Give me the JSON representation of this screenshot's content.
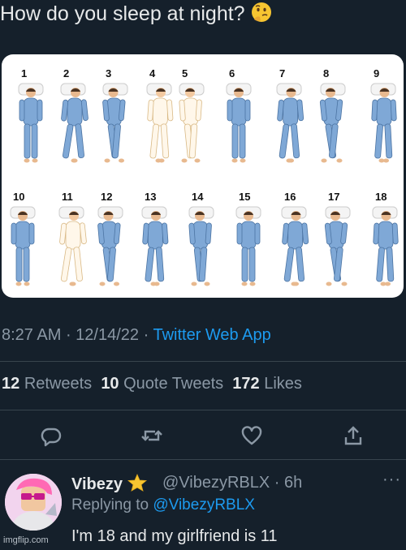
{
  "tweet": {
    "text": "How do you sleep at night?",
    "emoji": "thinking-face-icon"
  },
  "media": {
    "row1_numbers": [
      "1",
      "2",
      "3",
      "4",
      "5",
      "6",
      "7",
      "8",
      "9"
    ],
    "row2_numbers": [
      "10",
      "11",
      "12",
      "13",
      "14",
      "15",
      "16",
      "17",
      "18"
    ]
  },
  "meta": {
    "time": "8:27 AM",
    "sep1": " · ",
    "date": "12/14/22",
    "sep2": " · ",
    "app": "Twitter Web App"
  },
  "stats": {
    "retweets_count": "12",
    "retweets_label": "Retweets",
    "quotes_count": "10",
    "quotes_label": "Quote Tweets",
    "likes_count": "172",
    "likes_label": "Likes"
  },
  "actions": [
    "reply-icon",
    "retweet-icon",
    "like-icon",
    "share-icon"
  ],
  "reply": {
    "name": "Vibezy",
    "badge": "star-icon",
    "handle": "@VibezyRBLX",
    "time_sep": " · ",
    "time": "6h",
    "replying_prefix": "Replying to ",
    "replying_to": "@VibezyRBLX",
    "text": "I'm 18 and my girlfriend is 11",
    "more": "···"
  },
  "watermark": "imgflip.com",
  "colors": {
    "background": "#15202b",
    "text": "#e7e9ea",
    "muted": "#8b98a5",
    "link": "#1d9bf0",
    "pajama": "#7fa8d6"
  }
}
